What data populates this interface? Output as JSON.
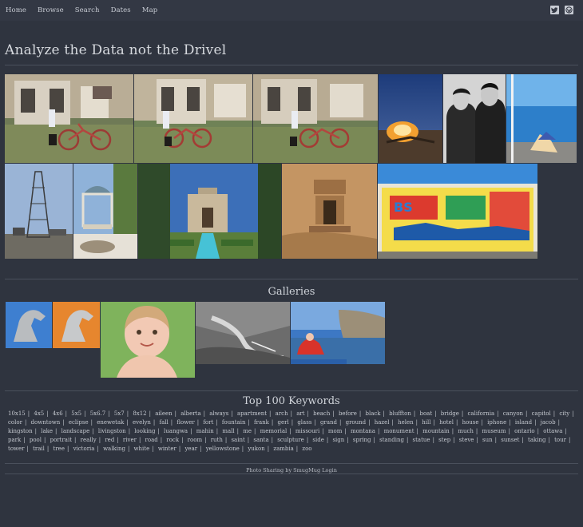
{
  "nav": {
    "items": [
      "Home",
      "Browse",
      "Search",
      "Dates",
      "Map"
    ]
  },
  "social": {
    "icons": [
      "twitter-icon",
      "wordpress-icon"
    ]
  },
  "page": {
    "title": "Analyze the Data not the Drivel"
  },
  "galleries": {
    "title": "Galleries"
  },
  "keywords": {
    "title": "Top 100 Keywords",
    "list": [
      "10x15",
      "4x5",
      "4x6",
      "5x5",
      "5x6.7",
      "5x7",
      "8x12",
      "aileen",
      "alberta",
      "always",
      "apartment",
      "arch",
      "art",
      "beach",
      "before",
      "black",
      "bluffton",
      "boat",
      "bridge",
      "california",
      "canyon",
      "capitol",
      "city",
      "color",
      "downtown",
      "eclipse",
      "enewetak",
      "evelyn",
      "fall",
      "flower",
      "fort",
      "fountain",
      "frank",
      "gerl",
      "glass",
      "grand",
      "ground",
      "hazel",
      "helen",
      "hill",
      "hotel",
      "house",
      "iphone",
      "island",
      "jacob",
      "kingston",
      "lake",
      "landscape",
      "livingston",
      "looking",
      "luangwa",
      "mahin",
      "mall",
      "me",
      "memorial",
      "missouri",
      "mom",
      "montana",
      "monument",
      "mountain",
      "much",
      "museum",
      "ontario",
      "ottawa",
      "park",
      "pool",
      "portrait",
      "really",
      "red",
      "river",
      "road",
      "rock",
      "room",
      "ruth",
      "saint",
      "santa",
      "sculpture",
      "side",
      "sign",
      "spring",
      "standing",
      "statue",
      "step",
      "steve",
      "sun",
      "sunset",
      "taking",
      "tour",
      "tower",
      "trail",
      "tree",
      "victoria",
      "walking",
      "white",
      "winter",
      "year",
      "yellowstone",
      "yukon",
      "zambia",
      "zoo"
    ]
  },
  "footer": {
    "text": "Photo Sharing by SmugMug Login"
  }
}
